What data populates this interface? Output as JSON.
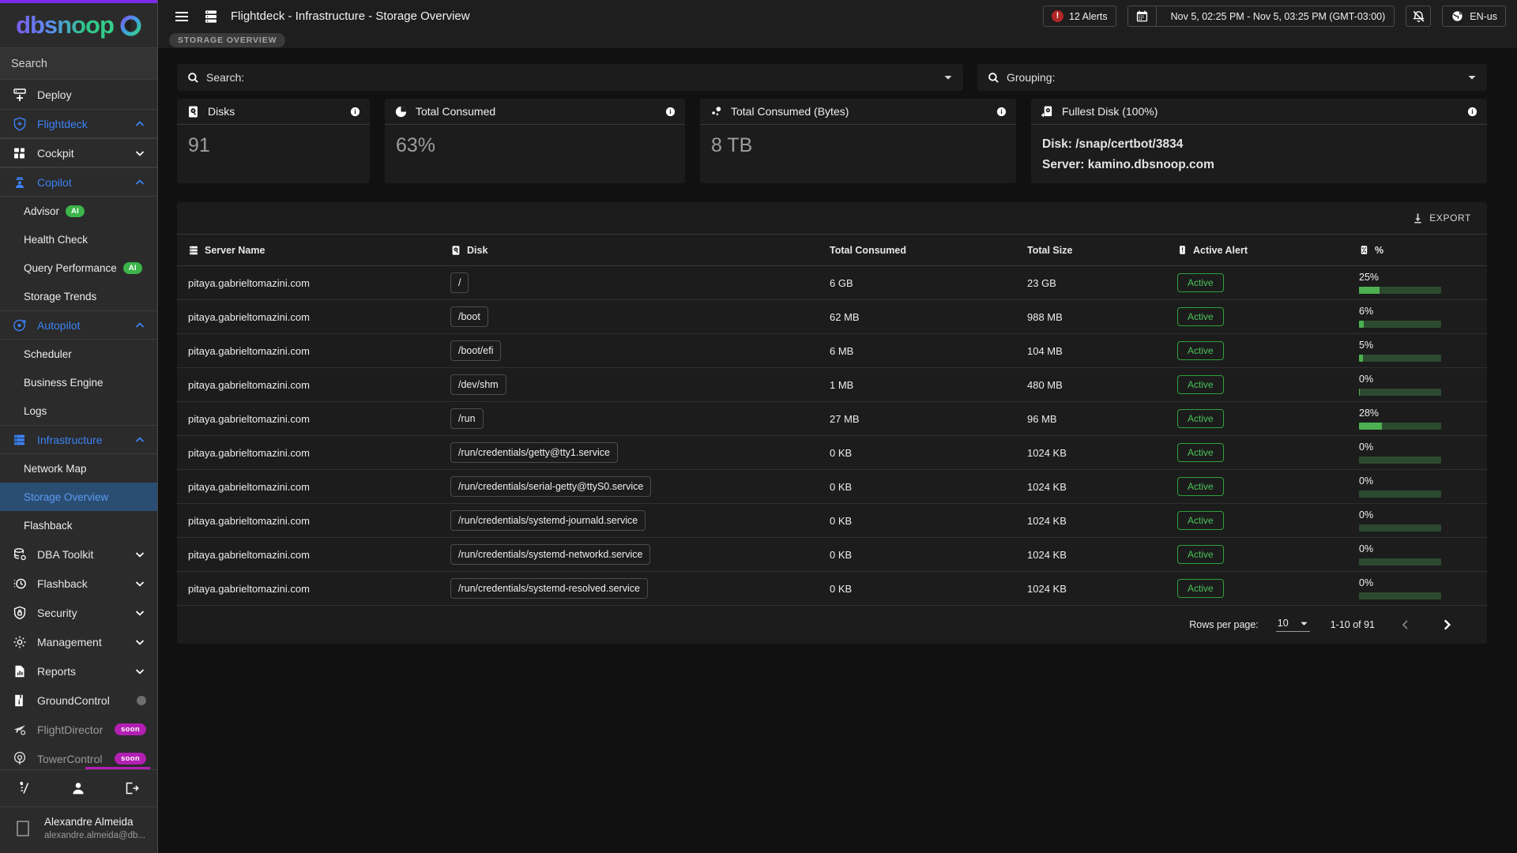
{
  "brand": {
    "name": "dbsnoop",
    "logo_icon": "dbsnoop-logo-icon"
  },
  "sidebar": {
    "search_label": "Search",
    "items": [
      {
        "label": "Deploy",
        "icon": "server-add-icon",
        "type": "item"
      },
      {
        "label": "Flightdeck",
        "icon": "shield-plane-icon",
        "type": "group",
        "state": "open"
      },
      {
        "label": "Cockpit",
        "icon": "dashboard-icon",
        "type": "group",
        "state": "closed"
      },
      {
        "label": "Copilot",
        "icon": "pilot-icon",
        "type": "group",
        "state": "open"
      },
      {
        "label": "Advisor",
        "badge": "AI",
        "type": "sub"
      },
      {
        "label": "Health Check",
        "type": "sub"
      },
      {
        "label": "Query Performance",
        "badge": "AI",
        "type": "sub"
      },
      {
        "label": "Storage Trends",
        "type": "sub"
      },
      {
        "label": "Autopilot",
        "icon": "autopilot-icon",
        "type": "group",
        "state": "open"
      },
      {
        "label": "Scheduler",
        "type": "sub"
      },
      {
        "label": "Business Engine",
        "type": "sub"
      },
      {
        "label": "Logs",
        "type": "sub"
      },
      {
        "label": "Infrastructure",
        "icon": "server-stack-icon",
        "type": "group",
        "state": "open"
      },
      {
        "label": "Network Map",
        "type": "sub"
      },
      {
        "label": "Storage Overview",
        "type": "sub",
        "active": true
      },
      {
        "label": "Flashback",
        "type": "sub"
      },
      {
        "label": "DBA Toolkit",
        "icon": "database-gear-icon",
        "type": "group",
        "state": "closed"
      },
      {
        "label": "Flashback",
        "icon": "clock-history-icon",
        "type": "group",
        "state": "closed"
      },
      {
        "label": "Security",
        "icon": "shield-lock-icon",
        "type": "group",
        "state": "closed"
      },
      {
        "label": "Management",
        "icon": "gear-icon",
        "type": "group",
        "state": "closed"
      },
      {
        "label": "Reports",
        "icon": "report-chart-icon",
        "type": "group",
        "state": "closed"
      },
      {
        "label": "GroundControl",
        "icon": "book-info-icon",
        "type": "item",
        "dot": true
      },
      {
        "label": "FlightDirector",
        "icon": "plane-pin-icon",
        "type": "item",
        "badge": "soon",
        "dim": true
      },
      {
        "label": "TowerControl",
        "icon": "tower-signal-icon",
        "type": "item",
        "badge": "soon",
        "dim": true
      }
    ],
    "actions": [
      {
        "icon": "shortcut-slash-icon"
      },
      {
        "icon": "user-icon"
      },
      {
        "icon": "logout-icon"
      }
    ],
    "user": {
      "name": "Alexandre Almeida",
      "email": "alexandre.almeida@db...",
      "avatar_icon": "avatar-icon"
    }
  },
  "topbar": {
    "menu_icon": "hamburger-menu-icon",
    "context_icon": "server-stack-icon",
    "title": "Flightdeck - Infrastructure - Storage Overview",
    "alerts": {
      "count": "12 Alerts",
      "icon": "alert-circle-icon"
    },
    "date_range": {
      "icon": "calendar-icon",
      "text": "Nov 5, 02:25 PM - Nov 5, 03:25 PM (GMT-03:00)"
    },
    "mute_icon": "bell-off-icon",
    "language": {
      "icon": "globe-icon",
      "label": "EN-us"
    }
  },
  "breadcrumb": "STORAGE OVERVIEW",
  "filters": {
    "search": {
      "icon": "search-icon",
      "label": "Search:",
      "value": "",
      "caret": "chevron-down-icon"
    },
    "grouping": {
      "icon": "search-icon",
      "label": "Grouping:",
      "value": "",
      "caret": "chevron-down-icon"
    }
  },
  "kpis": [
    {
      "title": "Disks",
      "icon": "disk-icon",
      "info_icon": "info-icon",
      "value": "91"
    },
    {
      "title": "Total Consumed",
      "icon": "pie-chart-icon",
      "info_icon": "info-icon",
      "value": "63%"
    },
    {
      "title": "Total Consumed (Bytes)",
      "icon": "scatter-dots-icon",
      "info_icon": "info-icon",
      "value": "8 TB"
    },
    {
      "title": "Fullest Disk (100%)",
      "icon": "disk-add-icon",
      "info_icon": "info-icon",
      "line1": "Disk: /snap/certbot/3834",
      "line2": "Server: kamino.dbsnoop.com"
    }
  ],
  "table": {
    "export_label": "EXPORT",
    "export_icon": "download-icon",
    "columns": [
      {
        "label": "Server Name",
        "icon": "server-stack-icon"
      },
      {
        "label": "Disk",
        "icon": "disk-icon"
      },
      {
        "label": "Total Consumed",
        "icon": null
      },
      {
        "label": "Total Size",
        "icon": null
      },
      {
        "label": "Active Alert",
        "icon": "alert-square-icon"
      },
      {
        "label": "%",
        "icon": "percent-icon"
      }
    ],
    "rows": [
      {
        "server": "pitaya.gabrieltomazini.com",
        "disk": "/",
        "consumed": "6 GB",
        "size": "23 GB",
        "alert": "Active",
        "pct_label": "25%",
        "pct": 25
      },
      {
        "server": "pitaya.gabrieltomazini.com",
        "disk": "/boot",
        "consumed": "62 MB",
        "size": "988 MB",
        "alert": "Active",
        "pct_label": "6%",
        "pct": 6
      },
      {
        "server": "pitaya.gabrieltomazini.com",
        "disk": "/boot/efi",
        "consumed": "6 MB",
        "size": "104 MB",
        "alert": "Active",
        "pct_label": "5%",
        "pct": 5
      },
      {
        "server": "pitaya.gabrieltomazini.com",
        "disk": "/dev/shm",
        "consumed": "1 MB",
        "size": "480 MB",
        "alert": "Active",
        "pct_label": "0%",
        "pct": 1
      },
      {
        "server": "pitaya.gabrieltomazini.com",
        "disk": "/run",
        "consumed": "27 MB",
        "size": "96 MB",
        "alert": "Active",
        "pct_label": "28%",
        "pct": 28
      },
      {
        "server": "pitaya.gabrieltomazini.com",
        "disk": "/run/credentials/getty@tty1.service",
        "consumed": "0 KB",
        "size": "1024 KB",
        "alert": "Active",
        "pct_label": "0%",
        "pct": 0
      },
      {
        "server": "pitaya.gabrieltomazini.com",
        "disk": "/run/credentials/serial-getty@ttyS0.service",
        "consumed": "0 KB",
        "size": "1024 KB",
        "alert": "Active",
        "pct_label": "0%",
        "pct": 0
      },
      {
        "server": "pitaya.gabrieltomazini.com",
        "disk": "/run/credentials/systemd-journald.service",
        "consumed": "0 KB",
        "size": "1024 KB",
        "alert": "Active",
        "pct_label": "0%",
        "pct": 0
      },
      {
        "server": "pitaya.gabrieltomazini.com",
        "disk": "/run/credentials/systemd-networkd.service",
        "consumed": "0 KB",
        "size": "1024 KB",
        "alert": "Active",
        "pct_label": "0%",
        "pct": 0
      },
      {
        "server": "pitaya.gabrieltomazini.com",
        "disk": "/run/credentials/systemd-resolved.service",
        "consumed": "0 KB",
        "size": "1024 KB",
        "alert": "Active",
        "pct_label": "0%",
        "pct": 0
      }
    ],
    "footer": {
      "rows_per_page_label": "Rows per page:",
      "rows_per_page_value": "10",
      "range_label": "1-10 of 91",
      "prev_icon": "chevron-left-icon",
      "next_icon": "chevron-right-icon"
    }
  },
  "colors": {
    "accent_purple": "#7c2ae8",
    "link_blue": "#3b82f6",
    "active_nav_bg": "#2a4d72",
    "green": "#4caf50",
    "green_track": "#2c4a2f",
    "alert_red": "#b02626",
    "badge_ai": "#3bb54a",
    "badge_soon": "#b31fb3"
  }
}
